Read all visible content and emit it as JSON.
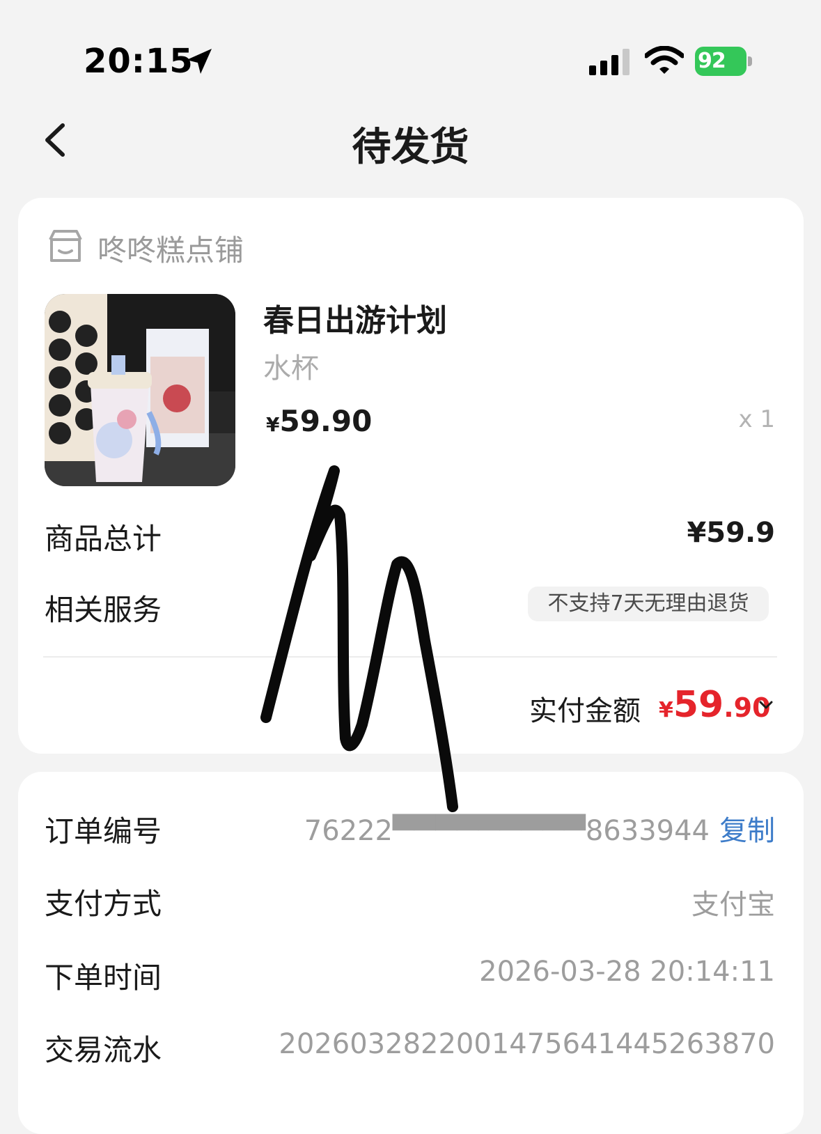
{
  "status_bar": {
    "time": "20:15",
    "battery": "92"
  },
  "nav": {
    "title": "待发货"
  },
  "order_card": {
    "store_name": "咚咚糕点铺",
    "product": {
      "title": "春日出游计划",
      "sku": "水杯",
      "price_symbol": "¥",
      "price": "59.90",
      "quantity": "x 1"
    },
    "subtotal_label": "商品总计",
    "subtotal_value": "¥59.9",
    "service_label": "相关服务",
    "service_badge": "不支持7天无理由退货",
    "paid_label": "实付金额",
    "paid_symbol": "¥",
    "paid_integer": "59",
    "paid_decimal": ".90"
  },
  "info_card": {
    "order_no_label": "订单编号",
    "order_no": "76222▀▀▀▀▀▀▀▀▀8633944",
    "copy_label": "复制",
    "pay_method_label": "支付方式",
    "pay_method": "支付宝",
    "order_time_label": "下单时间",
    "order_time": "2026-03-28 20:14:11",
    "txn_label": "交易流水",
    "txn_no": "2026032822001475641445263870"
  },
  "colors": {
    "accent_red": "#e5242b",
    "link_blue": "#3d7cc9",
    "battery_green": "#34c759"
  }
}
